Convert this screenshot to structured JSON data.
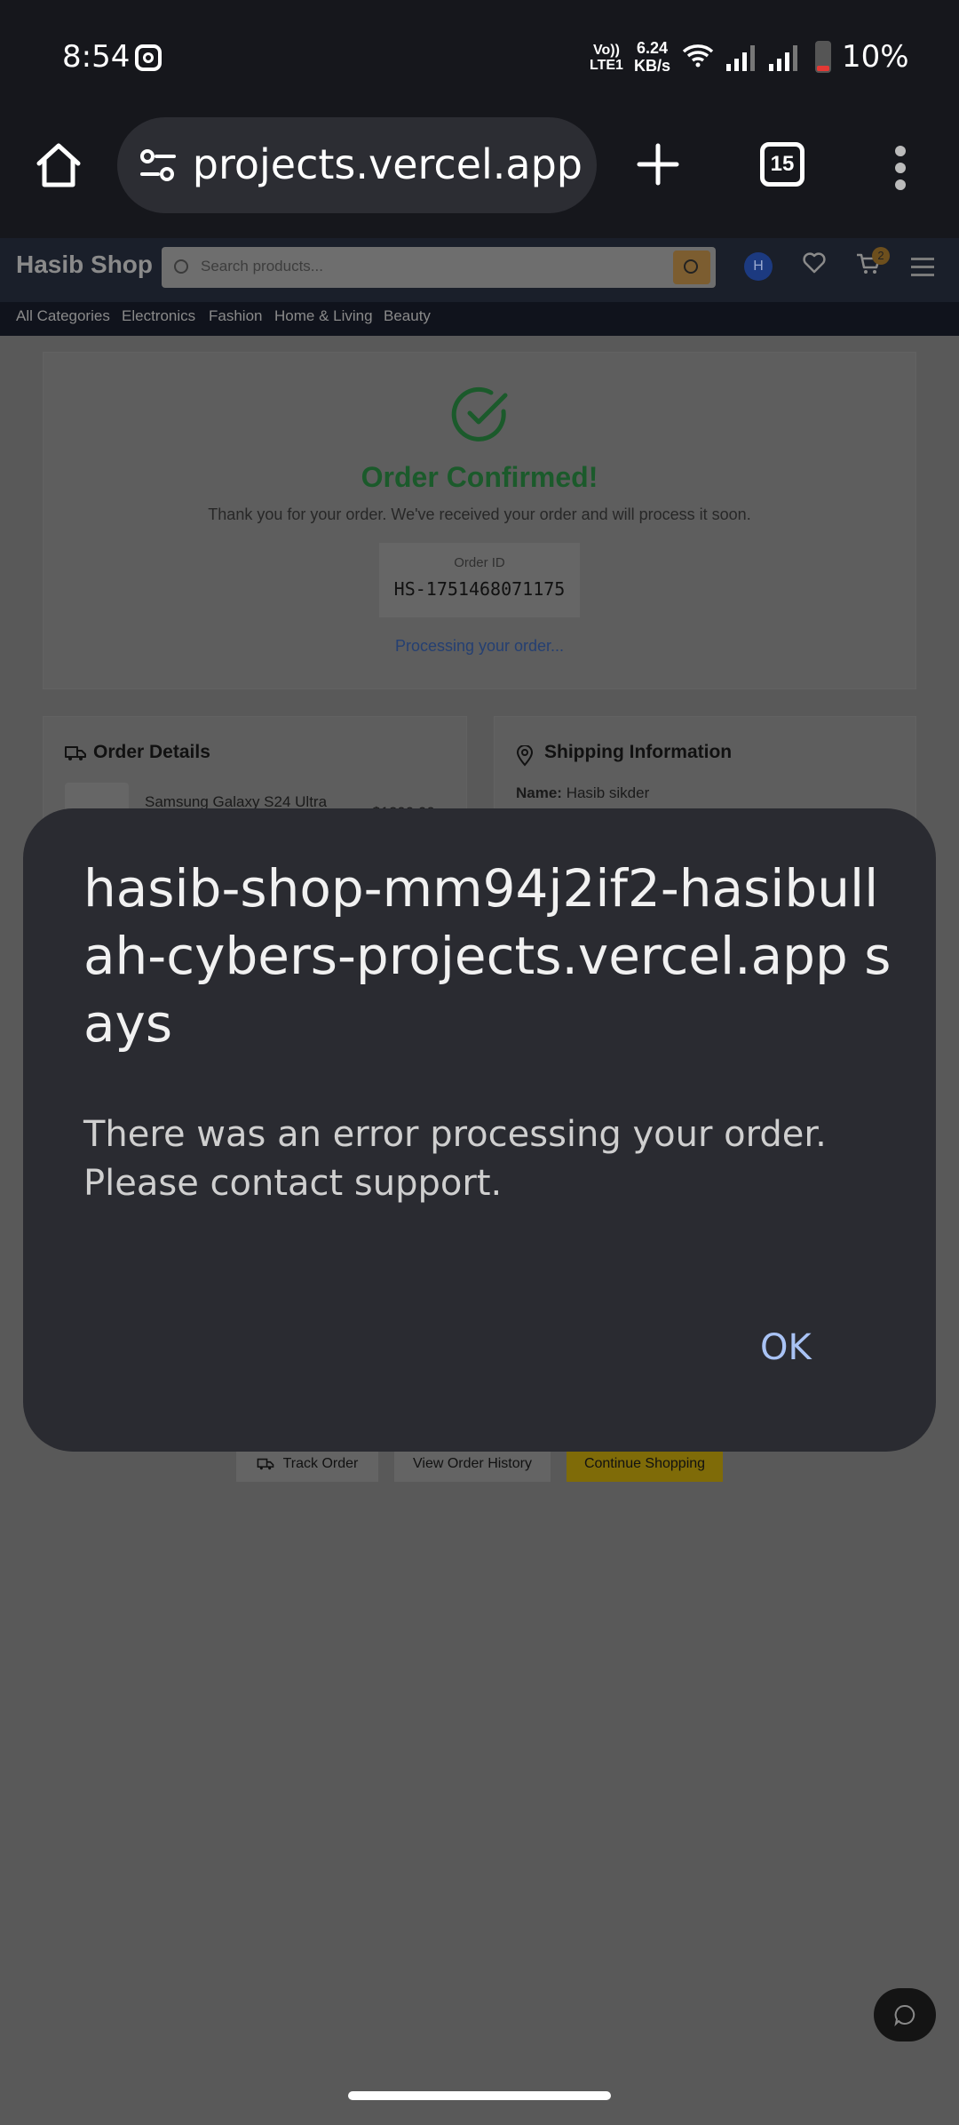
{
  "status_bar": {
    "time": "8:54",
    "volte": "Vo)) LTE1",
    "speed_value": "6.24",
    "speed_unit": "KB/s",
    "battery": "10%"
  },
  "browser": {
    "url": "hasib-shop-mm94j2if2-hasibullah-cybers-projects.vercel.app",
    "tab_count": "15"
  },
  "site": {
    "brand": "Hasib Shop",
    "search_placeholder": "Search products...",
    "user_initial": "H",
    "cart_count": "2",
    "categories": [
      "All Categories",
      "Electronics",
      "Fashion",
      "Home & Living",
      "Beauty"
    ]
  },
  "confirmation": {
    "title": "Order Confirmed!",
    "message": "Thank you for your order. We've received your order and will process it soon.",
    "order_id_label": "Order ID",
    "order_id": "HS-1751468071175",
    "status": "Processing your order..."
  },
  "order_details": {
    "title": "Order Details",
    "product_name": "Samsung Galaxy S24 Ultra",
    "product_price": "$1299.99"
  },
  "shipping": {
    "title": "Shipping Information",
    "name_label": "Name:",
    "name_value": "Hasib sikder"
  },
  "actions": {
    "track": "Track Order",
    "history": "View Order History",
    "continue": "Continue Shopping"
  },
  "dialog": {
    "title": "hasib-shop-mm94j2if2-hasibullah-cybers-projects.vercel.app says",
    "message": "There was an error processing your order. Please contact support.",
    "ok_label": "OK"
  },
  "colors": {
    "dialog_bg": "#2a2b31",
    "ok_accent": "#a9c3f5",
    "success_green": "#1b5a2b",
    "continue_yellow": "#7f6b08"
  }
}
